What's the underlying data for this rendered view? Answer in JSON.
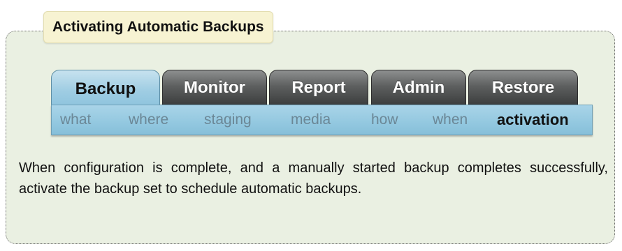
{
  "panel": {
    "legend_title": "Activating Automatic Backups"
  },
  "tabs": [
    {
      "label": "Backup",
      "active": true
    },
    {
      "label": "Monitor",
      "active": false
    },
    {
      "label": "Report",
      "active": false
    },
    {
      "label": "Admin",
      "active": false
    },
    {
      "label": "Restore",
      "active": false
    }
  ],
  "subnav": [
    {
      "label": "what",
      "current": false
    },
    {
      "label": "where",
      "current": false
    },
    {
      "label": "staging",
      "current": false
    },
    {
      "label": "media",
      "current": false
    },
    {
      "label": "how",
      "current": false
    },
    {
      "label": "when",
      "current": false
    },
    {
      "label": "activation",
      "current": true
    }
  ],
  "description": "When configuration is complete, and a manually started backup completes successfully, activate the backup set to schedule automatic backups.",
  "colors": {
    "panel_background": "#eaf0e2",
    "legend_background": "#f7f3d2",
    "active_tab": "#9fcde3",
    "inactive_tab": "#5e6060",
    "subnav_background": "#93c8e0",
    "subnav_inactive_text": "#6b8796",
    "subnav_active_text": "#111111"
  }
}
